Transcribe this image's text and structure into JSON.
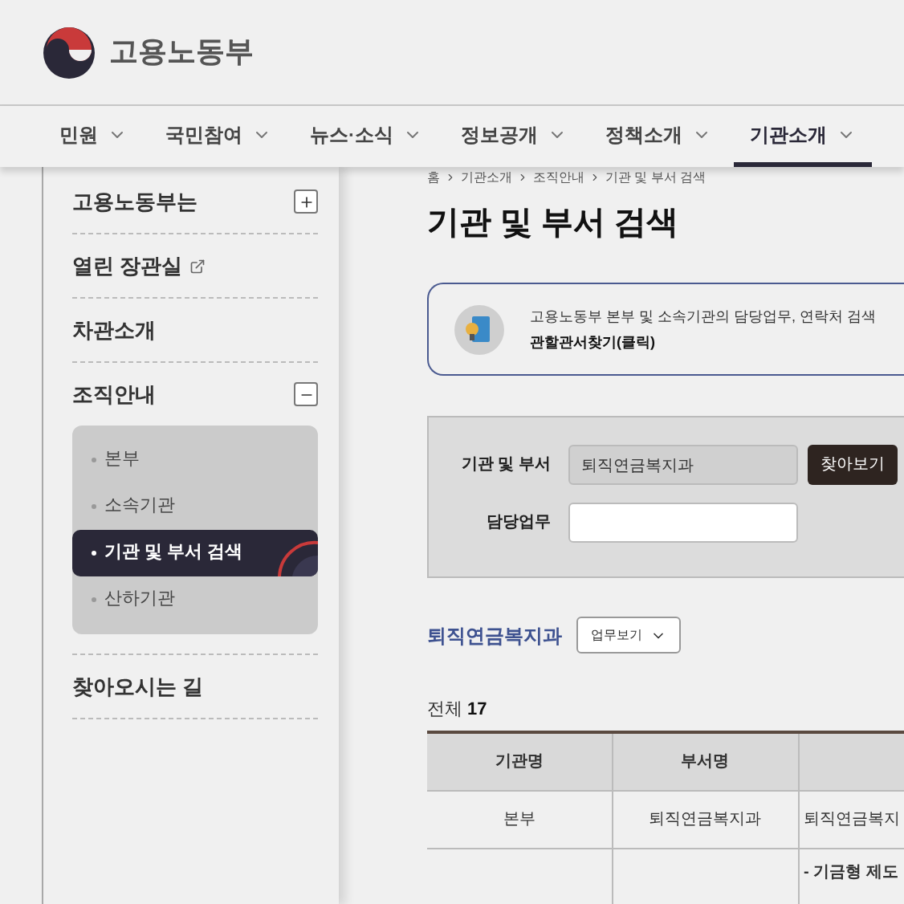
{
  "header": {
    "logo_text": "고용노동부"
  },
  "nav": [
    {
      "label": "민원",
      "selected": false
    },
    {
      "label": "국민참여",
      "selected": false
    },
    {
      "label": "뉴스·소식",
      "selected": false
    },
    {
      "label": "정보공개",
      "selected": false
    },
    {
      "label": "정책소개",
      "selected": false
    },
    {
      "label": "기관소개",
      "selected": true
    }
  ],
  "sidebar": {
    "items": [
      {
        "label": "고용노동부는",
        "kind": "expandable",
        "expanded": false
      },
      {
        "label": "열린 장관실",
        "kind": "external"
      },
      {
        "label": "차관소개",
        "kind": "plain"
      },
      {
        "label": "조직안내",
        "kind": "expandable",
        "expanded": true,
        "children": [
          {
            "label": "본부",
            "selected": false
          },
          {
            "label": "소속기관",
            "selected": false
          },
          {
            "label": "기관 및 부서 검색",
            "selected": true
          },
          {
            "label": "산하기관",
            "selected": false
          }
        ]
      },
      {
        "label": "찾아오시는 길",
        "kind": "plain"
      }
    ]
  },
  "breadcrumb": [
    "홈",
    "기관소개",
    "조직안내",
    "기관 및 부서 검색"
  ],
  "page_title": "기관 및 부서 검색",
  "info_box": {
    "text": "고용노동부 본부 및 소속기관의 담당업무, 연락처 검색",
    "link": "관할관서찾기(클릭)"
  },
  "search_form": {
    "fields": [
      {
        "label": "기관 및 부서",
        "value": "퇴직연금복지과"
      },
      {
        "label": "담당업무"
      }
    ],
    "button": "찾아보기"
  },
  "department": {
    "name": "퇴직연금복지과",
    "dropdown": "업무보기"
  },
  "result": {
    "total_label": "전체",
    "total": "17"
  },
  "table": {
    "columns": [
      "기관명",
      "부서명"
    ],
    "rows": [
      [
        "본부",
        "퇴직연금복지과",
        "퇴직연금복지"
      ],
      [
        "",
        "",
        "- 기금형 제도"
      ]
    ]
  }
}
